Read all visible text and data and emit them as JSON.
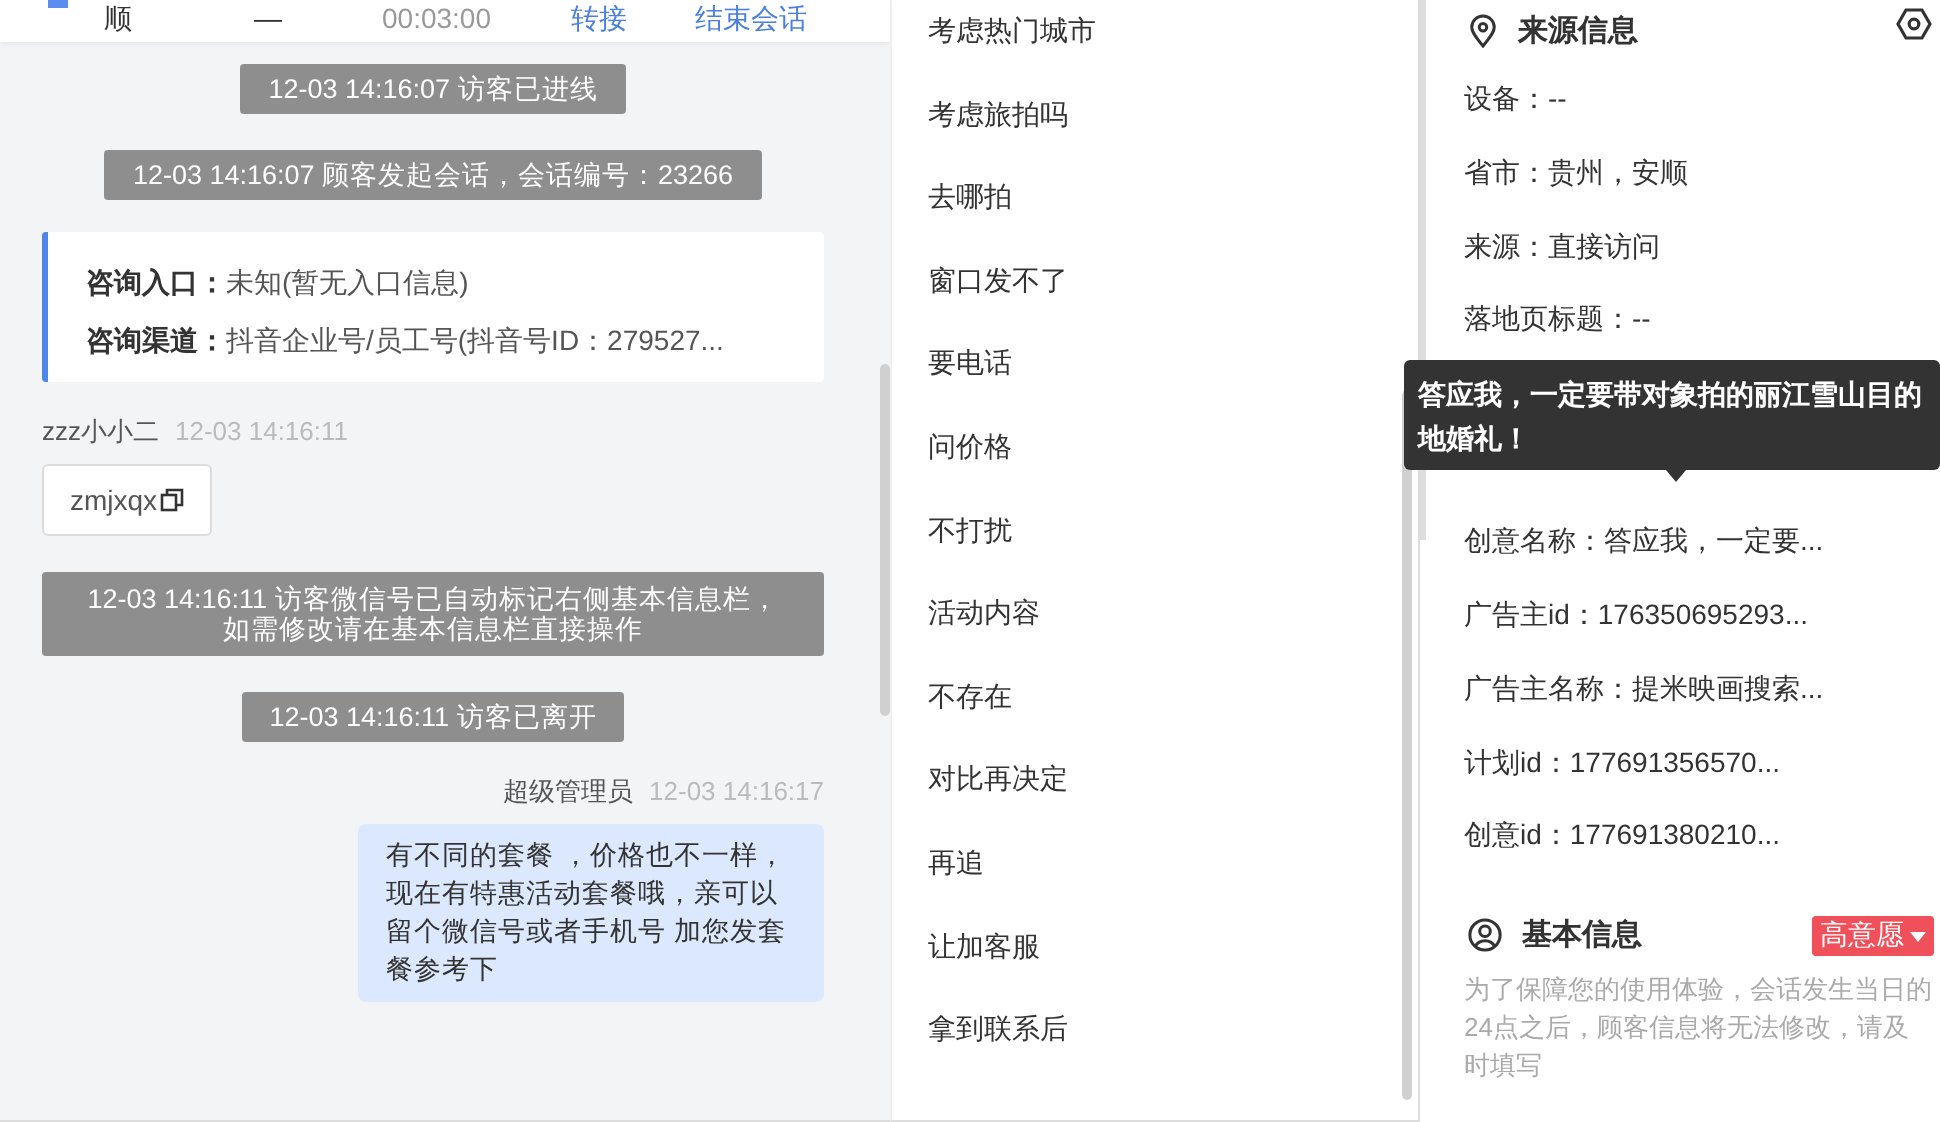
{
  "header": {
    "name": "顺",
    "dash": "—",
    "duration": "00:03:00",
    "actions": [
      "转接",
      "结束会话"
    ]
  },
  "messages": [
    {
      "kind": "system",
      "text": "12-03 14:16:07 访客已进线"
    },
    {
      "kind": "system",
      "text": "12-03 14:16:07 顾客发起会话，会话编号：23266"
    },
    {
      "kind": "info",
      "rows": [
        {
          "label": "咨询入口：",
          "value": "未知(暂无入口信息)"
        },
        {
          "label": "咨询渠道：",
          "value": "抖音企业号/员工号(抖音号ID：279527..."
        }
      ]
    },
    {
      "kind": "visitor",
      "sender": "zzz小小二",
      "time": "12-03 14:16:11",
      "text": "zmjxqx"
    },
    {
      "kind": "system",
      "text": "12-03 14:16:11 访客微信号已自动标记右侧基本信息栏，如需修改请在基本信息栏直接操作"
    },
    {
      "kind": "system",
      "text": "12-03 14:16:11 访客已离开"
    },
    {
      "kind": "agent",
      "sender": "超级管理员",
      "time": "12-03 14:16:17",
      "text": "有不同的套餐 ，价格也不一样，现在有特惠活动套餐哦，亲可以留个微信号或者手机号 加您发套餐参考下"
    }
  ],
  "quick_replies": [
    "考虑热门城市",
    "考虑旅拍吗",
    "去哪拍",
    "窗口发不了",
    "要电话",
    "问价格",
    "不打扰",
    "活动内容",
    "不存在",
    "对比再决定",
    "再追",
    "让加客服",
    "拿到联系后"
  ],
  "source_info": {
    "title": "来源信息",
    "rows": [
      {
        "label": "设备：",
        "value": "--"
      },
      {
        "label": "省市：",
        "value": "贵州，安顺"
      },
      {
        "label": "来源：",
        "value": "直接访问"
      },
      {
        "label": "落地页标题：",
        "value": "--"
      }
    ],
    "more_rows": [
      {
        "label": "创意名称：",
        "value": "答应我，一定要..."
      },
      {
        "label": "广告主id：",
        "value": "176350695293..."
      },
      {
        "label": "广告主名称：",
        "value": "提米映画搜索..."
      },
      {
        "label": "计划id：",
        "value": "177691356570..."
      },
      {
        "label": "创意id：",
        "value": "177691380210..."
      }
    ]
  },
  "tooltip": "答应我，一定要带对象拍的丽江雪山目的地婚礼！",
  "basic_info": {
    "title": "基本信息",
    "tag": "高意愿",
    "note": "为了保障您的使用体验，会话发生当日的24点之后，顾客信息将无法修改，请及时填写"
  }
}
